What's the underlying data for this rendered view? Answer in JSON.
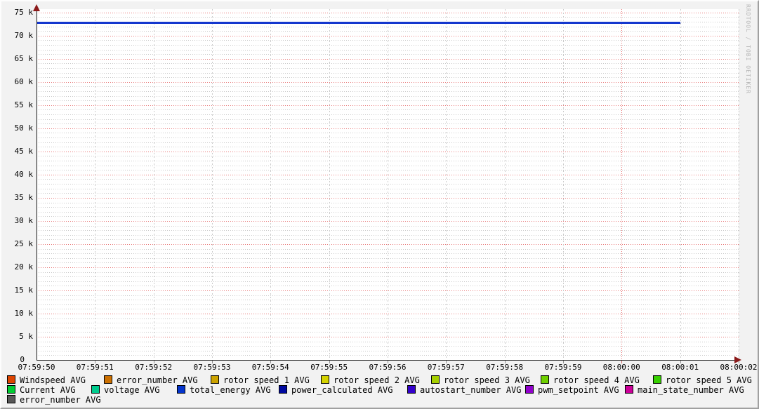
{
  "watermark": "RRDTOOL / TOBI OETIKER",
  "chart_data": {
    "type": "line",
    "title": "",
    "xlabel": "",
    "ylabel": "",
    "x_tick_labels": [
      "07:59:50",
      "07:59:51",
      "07:59:52",
      "07:59:53",
      "07:59:54",
      "07:59:55",
      "07:59:56",
      "07:59:57",
      "07:59:58",
      "07:59:59",
      "08:00:00",
      "08:00:01",
      "08:00:02"
    ],
    "x_major_tick_index": 10,
    "y_axis": {
      "unit": "k",
      "max_k": 75,
      "major_step_k": 5,
      "minor_step_k": 1,
      "labels_bottom_up": [
        "0",
        "5 k",
        "10 k",
        "15 k",
        "20 k",
        "25 k",
        "30 k",
        "35 k",
        "40 k",
        "45 k",
        "50 k",
        "55 k",
        "60 k",
        "65 k",
        "70 k",
        "75 k"
      ]
    },
    "ylim": [
      0,
      75700
    ],
    "grid": {
      "major_color": "#e87878",
      "minor_color": "#c9c9c9",
      "grid_on": true
    },
    "series": [
      {
        "name": "total_energy AVG",
        "type": "line",
        "color": "#1437ce",
        "constant_value": 72700,
        "x_start": "07:59:50",
        "x_end": "08:00:01",
        "points": [
          [
            "07:59:50",
            72700
          ],
          [
            "08:00:01",
            72700
          ]
        ]
      }
    ],
    "legend": {
      "position": "bottom",
      "rows": [
        [
          {
            "label": "Windspeed AVG",
            "color": "#dd4400"
          },
          {
            "label": "error_number AVG",
            "color": "#cc7000"
          },
          {
            "label": "rotor speed 1 AVG",
            "color": "#cca300"
          },
          {
            "label": "rotor speed 2 AVG",
            "color": "#d5d300"
          },
          {
            "label": "rotor speed 3 AVG",
            "color": "#a6d000"
          },
          {
            "label": "rotor speed 4 AVG",
            "color": "#6fd000"
          },
          {
            "label": "rotor speed 5 AVG",
            "color": "#37d000"
          }
        ],
        [
          {
            "label": "Current AVG",
            "color": "#00cc33"
          },
          {
            "label": "voltage AVG",
            "color": "#00cc8e"
          },
          {
            "label": "total_energy AVG",
            "color": "#0434cc"
          },
          {
            "label": "power_calculated AVG",
            "color": "#0009a0"
          },
          {
            "label": "autostart_number AVG",
            "color": "#3300cc"
          },
          {
            "label": "pwm_setpoint AVG",
            "color": "#9000cc"
          },
          {
            "label": "main_state_number AVG",
            "color": "#cc0099"
          }
        ],
        [
          {
            "label": "error_number AVG",
            "color": "#575757"
          }
        ]
      ]
    }
  }
}
